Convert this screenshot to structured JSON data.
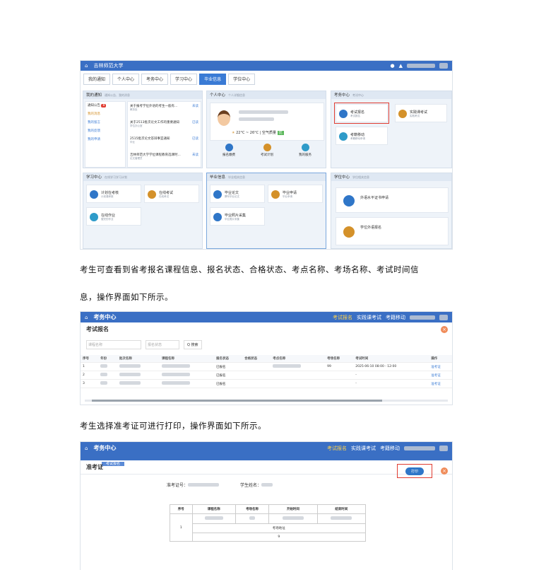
{
  "portal": {
    "university": "吉林师范大学",
    "tabs": [
      "我的通知",
      "个人中心",
      "考务中心",
      "学习中心",
      "毕业信息",
      "学位中心"
    ],
    "notice_panel": {
      "title": "我的通知",
      "hint": "通知公告、我的消息",
      "menu": [
        "通知公告",
        "我的消息",
        "我的留言",
        "我的反馈",
        "我的申请"
      ],
      "items": [
        {
          "text": "关于报考学位外语的考生一般有...",
          "meta": "教务处",
          "status": "未读"
        },
        {
          "text": "关于2513批次论文工作的重要通知",
          "meta": "学位办公室",
          "status": "已读"
        },
        {
          "text": "2515批次论文答辩事宜通知",
          "meta": "毕业",
          "status": "已读"
        },
        {
          "text": "吉林师范大学学位课程教育选课时...",
          "meta": "论文管理员",
          "status": "未读"
        }
      ]
    },
    "personal_panel": {
      "title": "个人中心",
      "hint": "个人详细信息",
      "weather": "22°C ~ 26°C | 空气质量",
      "weather_badge": "优",
      "actions": [
        "报名缴费",
        "考试计划",
        "我的服务"
      ]
    },
    "exam_panel": {
      "title": "考务中心",
      "hint": "考试中心",
      "items": [
        {
          "label": "考试报名",
          "sub": "考试报名"
        },
        {
          "label": "实践课考试",
          "sub": "实践考试"
        },
        {
          "label": "考籍移动",
          "sub": "考籍移动申请"
        }
      ]
    },
    "study_panel": {
      "title": "学习中心",
      "hint": "在线学习学习计划",
      "items": [
        {
          "label": "计划在考核",
          "sub": "计划课考核"
        },
        {
          "label": "在线考试",
          "sub": "在线考试"
        },
        {
          "label": "在线作业",
          "sub": "做完的作业"
        }
      ]
    },
    "grad_panel": {
      "title": "毕业信息",
      "hint": "毕业相关信息",
      "items": [
        {
          "label": "毕业论文",
          "sub": "撰写毕业论文"
        },
        {
          "label": "毕业申请",
          "sub": "毕业申请"
        },
        {
          "label": "毕业照片采集",
          "sub": "毕业照片采集"
        }
      ]
    },
    "degree_panel": {
      "title": "学位中心",
      "hint": "学位相关信息",
      "items": [
        {
          "label": "外语水平证书申请"
        },
        {
          "label": "学位外语报名"
        }
      ]
    }
  },
  "para1": "考生可查看到省考报名课程信息、报名状态、合格状态、考点名称、考场名称、考试时间信",
  "para1b": "息，操作界面如下所示。",
  "exam_list": {
    "app_title": "考务中心",
    "nav": [
      "考试报名",
      "实践课考试",
      "考籍移动"
    ],
    "page_title": "考试报名",
    "filter_placeholder": "课程名称",
    "filter_select": "报名状态",
    "search_button": "Q 搜索",
    "headers": [
      "序号",
      "年份",
      "批次名称",
      "课程名称",
      "报名状态",
      "合格状态",
      "考点名称",
      "考场名称",
      "考试时间",
      "操作"
    ],
    "rows": [
      {
        "no": "1",
        "status": "已报名",
        "room": "99",
        "time": "2025-06-10 08:00 - 12:00",
        "action": "准考证"
      },
      {
        "no": "2",
        "status": "已报名",
        "room": "",
        "time": "-",
        "action": "准考证"
      },
      {
        "no": "3",
        "status": "已报名",
        "room": "",
        "time": "-",
        "action": "准考证"
      }
    ]
  },
  "para2": "考生选择准考证可进行打印，操作界面如下所示。",
  "admission": {
    "app_title": "考务中心",
    "nav": [
      "考试报名",
      "实践课考试",
      "考籍移动"
    ],
    "breadcrumb": "考试报名",
    "page_title": "准考证",
    "print_button": "打印",
    "ticket_label": "准考证号：",
    "name_label": "学生姓名：",
    "headers": [
      "序号",
      "课程名称",
      "考场名称",
      "开始时间",
      "结束时间"
    ],
    "row_no": "1",
    "site_label": "考场地址",
    "site_value": "9"
  }
}
